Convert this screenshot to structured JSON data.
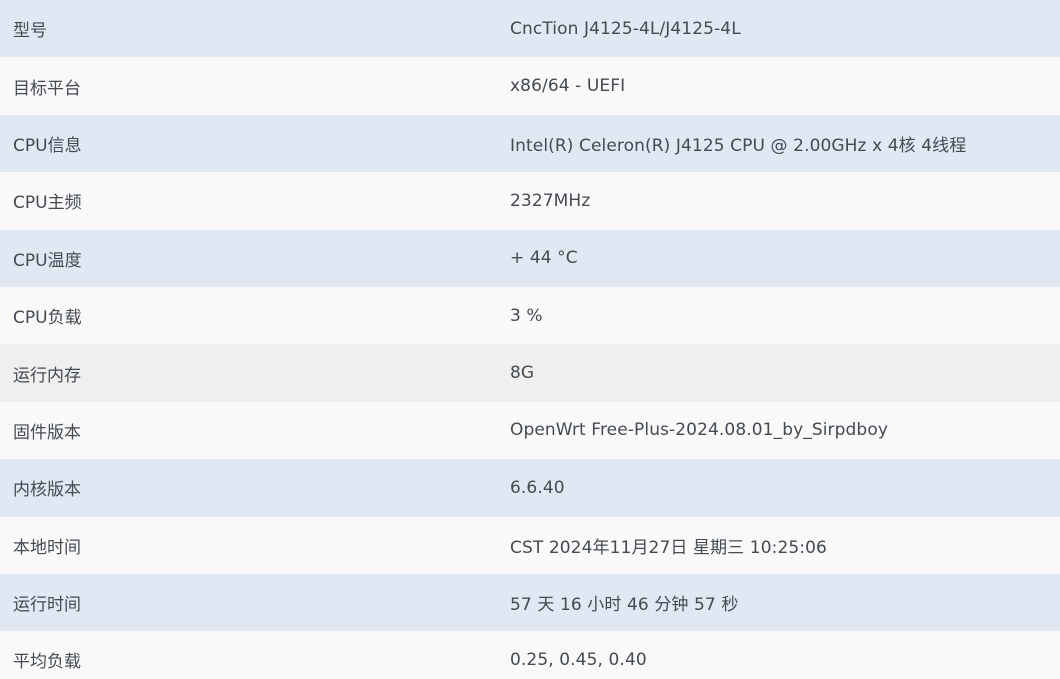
{
  "system_status": {
    "rows": [
      {
        "label": "型号",
        "value": "CncTion J4125-4L/J4125-4L",
        "shade": "blue"
      },
      {
        "label": "目标平台",
        "value": "x86/64 - UEFI",
        "shade": "white"
      },
      {
        "label": "CPU信息",
        "value": "Intel(R) Celeron(R) J4125 CPU @ 2.00GHz x 4核 4线程",
        "shade": "blue"
      },
      {
        "label": "CPU主频",
        "value": "2327MHz",
        "shade": "white"
      },
      {
        "label": "CPU温度",
        "value": "+ 44 °C",
        "shade": "blue"
      },
      {
        "label": "CPU负载",
        "value": "3 %",
        "shade": "white"
      },
      {
        "label": "运行内存",
        "value": "8G",
        "shade": "hover"
      },
      {
        "label": "固件版本",
        "value": "OpenWrt Free-Plus-2024.08.01_by_Sirpdboy",
        "shade": "white"
      },
      {
        "label": "内核版本",
        "value": "6.6.40",
        "shade": "blue"
      },
      {
        "label": "本地时间",
        "value": "CST 2024年11月27日 星期三 10:25:06",
        "shade": "white"
      },
      {
        "label": "运行时间",
        "value": "57 天 16 小时 46 分钟 57 秒",
        "shade": "blue"
      },
      {
        "label": "平均负载",
        "value": "0.25, 0.45, 0.40",
        "shade": "white"
      }
    ]
  },
  "colors": {
    "row_blue": "#e1e8f3",
    "row_white": "#f9f9f9",
    "row_hover": "#efefef",
    "text": "#444a52"
  }
}
